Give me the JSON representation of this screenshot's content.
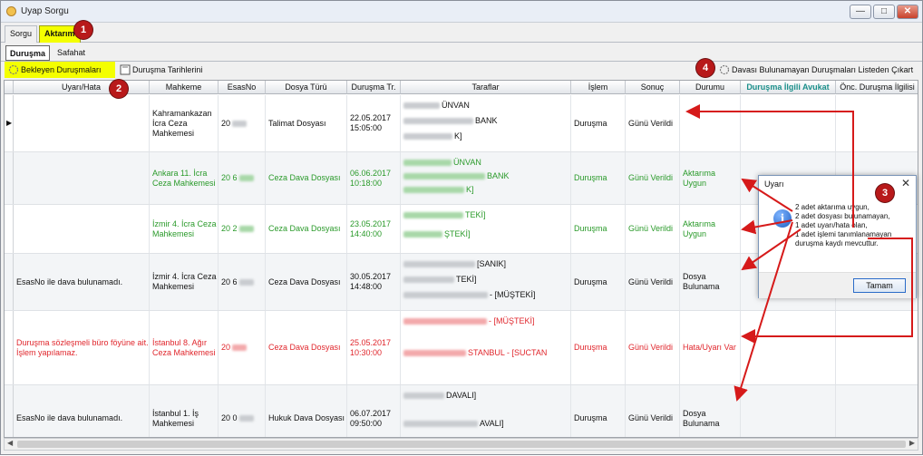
{
  "window": {
    "title": "Uyap Sorgu",
    "minimize": "—",
    "maximize": "□",
    "close": "✕"
  },
  "tabs_top": [
    {
      "label": "Sorgu"
    },
    {
      "label": "Aktarım"
    }
  ],
  "tabs_sub": [
    {
      "label": "Duruşma"
    },
    {
      "label": "Safahat"
    }
  ],
  "toolbar": {
    "list_button": "Bekleyen Duruşmaları Listele",
    "transfer_button": "Duruşma Tarihlerini Aktar",
    "remove_button": "Davası Bulunamayan Duruşmaları Listeden Çıkart Getirme"
  },
  "markers": [
    "1",
    "2",
    "3",
    "4"
  ],
  "columns": [
    "Uyarı/Hata",
    "Mahkeme",
    "EsasNo",
    "Dosya Türü",
    "Duruşma Tr.",
    "Taraflar",
    "İşlem",
    "Sonuç",
    "Durumu",
    "Duruşma İlgili Avukat",
    "Önc. Duruşma İlgilisi"
  ],
  "rows": [
    {
      "uyari": "",
      "mahkeme": "Kahramankazan İcra Ceza Mahkemesi",
      "esas": "20",
      "dosya": "Talimat Dosyası",
      "tarih": "22.05.2017 15:05:00",
      "taraflar": [
        "ÜNVAN",
        "BANK",
        "K]"
      ],
      "islem": "Duruşma",
      "sonuc": "Günü Verildi",
      "durum": "",
      "color": "normal"
    },
    {
      "uyari": "",
      "mahkeme": "Ankara 11. İcra Ceza Mahkemesi",
      "esas": "20   6",
      "dosya": "Ceza Dava Dosyası",
      "tarih": "06.06.2017 10:18:00",
      "taraflar": [
        "ÜNVAN",
        "BANK",
        "K]"
      ],
      "islem": "Duruşma",
      "sonuc": "Günü Verildi",
      "durum": "Aktarıma Uygun",
      "color": "green"
    },
    {
      "uyari": "",
      "mahkeme": "İzmir 4. İcra Ceza Mahkemesi",
      "esas": "20   2",
      "dosya": "Ceza Dava Dosyası",
      "tarih": "23.05.2017 14:40:00",
      "taraflar": [
        "TEKİ]",
        "ŞTEKİ]"
      ],
      "islem": "Duruşma",
      "sonuc": "Günü Verildi",
      "durum": "Aktarıma Uygun",
      "color": "green"
    },
    {
      "uyari": "EsasNo ile dava bulunamadı.",
      "mahkeme": "İzmir 4. İcra Ceza Mahkemesi",
      "esas": "20   6",
      "dosya": "Ceza Dava Dosyası",
      "tarih": "30.05.2017 14:48:00",
      "taraflar": [
        "[SANIK]",
        "TEKİ]",
        "- [MÜŞTEKİ]"
      ],
      "islem": "Duruşma",
      "sonuc": "Günü Verildi",
      "durum": "Dosya Bulunama",
      "color": "normal"
    },
    {
      "uyari": "Duruşma sözleşmeli büro föyüne ait. İşlem yapılamaz.",
      "mahkeme": "İstanbul 8. Ağır Ceza Mahkemesi",
      "esas": "20",
      "dosya": "Ceza Dava Dosyası",
      "tarih": "25.05.2017 10:30:00",
      "taraflar": [
        "- [MÜŞTEKİ]",
        "STANBUL - [SUCTAN"
      ],
      "islem": "Duruşma",
      "sonuc": "Günü Verildi",
      "durum": "Hata/Uyarı Var",
      "color": "red"
    },
    {
      "uyari": "EsasNo ile dava bulunamadı.",
      "mahkeme": "İstanbul 1. İş Mahkemesi",
      "esas": "20   0",
      "dosya": "Hukuk Dava Dosyası",
      "tarih": "06.07.2017 09:50:00",
      "taraflar": [
        "DAVALI]",
        "AVALI]"
      ],
      "islem": "Duruşma",
      "sonuc": "Günü Verildi",
      "durum": "Dosya Bulunama",
      "color": "normal"
    }
  ],
  "dialog": {
    "title": "Uyarı",
    "close": "✕",
    "icon": "i",
    "lines": [
      "2 adet aktarıma uygun,",
      "2 adet dosyası bulunamayan,",
      "1 adet uyarı/hata olan,",
      "1 adet işlemi tanımlanamayan",
      "duruşma kaydı mevcuttur."
    ],
    "ok": "Tamam"
  },
  "colors": {
    "highlight": "#f4ff00",
    "marker": "#b8191a",
    "green": "#2a9a2a",
    "red": "#e0262c",
    "teal": "#1b8f8a"
  }
}
